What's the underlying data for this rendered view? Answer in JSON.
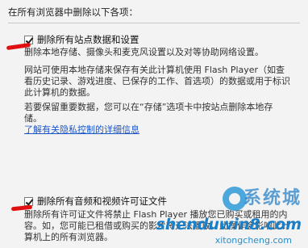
{
  "title": "在所有浏览器中删除以下各项：",
  "option1": {
    "label": "删除所有站点数据和设置",
    "description": "删除本地存储、摄像头和麦克风设置以及对等协助网络设置。"
  },
  "info": "网站可使用本地存储来保存有关此计算机使用 Flash Player（如查看历史记录、游戏进度、已保存的工作、首选项）的数据或用于标识此计算机的数据。",
  "tip": "若要保留重要数据，您可以在“存储”选项卡中按站点删除本地存储。",
  "privacy_link": "了解有关隐私控制的详细信息",
  "option2": {
    "label": "删除所有音频和视频许可证文件",
    "description": "删除所有许可证文件将禁止 Flash Player 播放您已购买或租用的内容。如，您可能已租借或购买的影片将无法播放。此操作会影响此计算机上的所有浏览器。"
  },
  "watermark": {
    "cn": "系统城",
    "url": "shenduwin8.com",
    "sub": "xitongcheng.com"
  },
  "colors": {
    "mark": "#e01010",
    "link": "#1a56c8"
  }
}
